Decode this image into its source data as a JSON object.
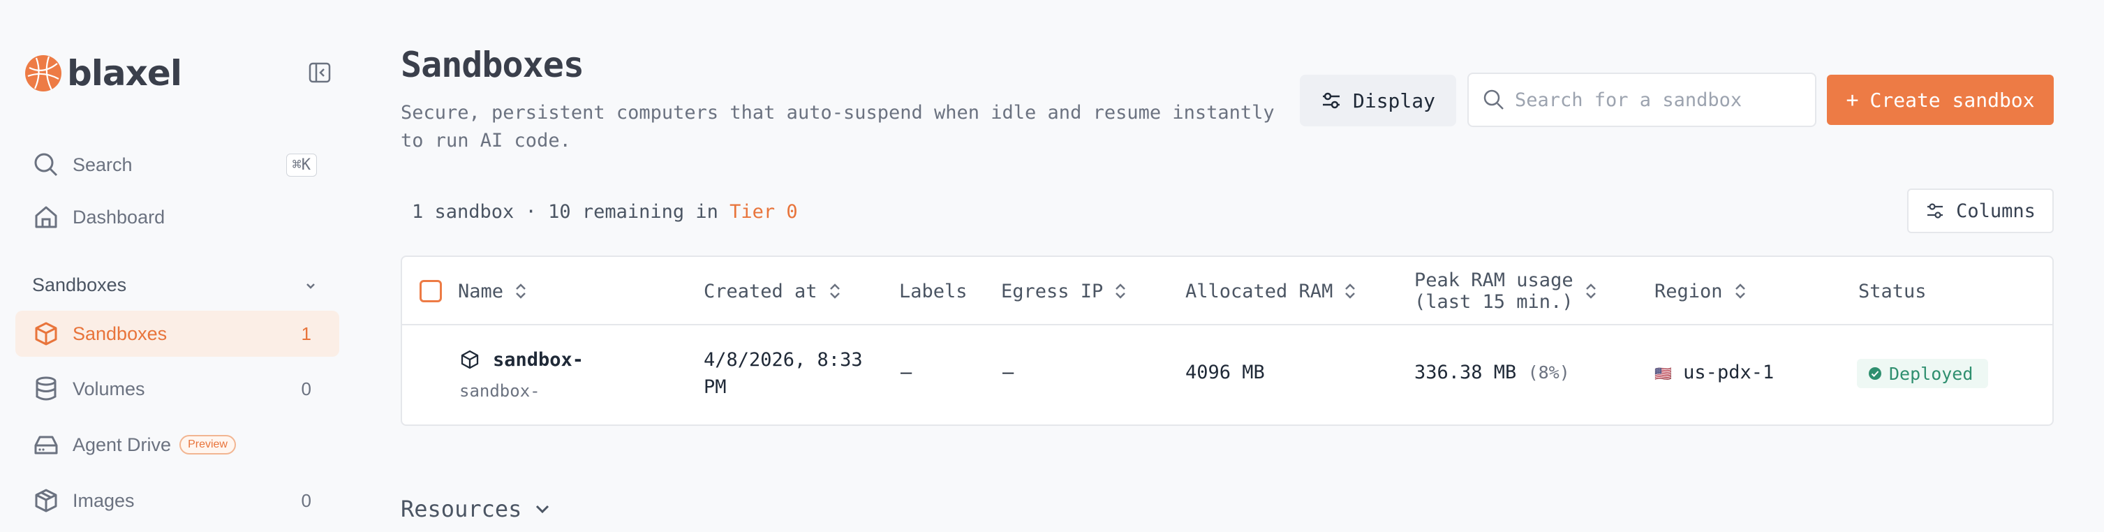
{
  "brand": {
    "name": "blaxel",
    "accent": "#ed7b45"
  },
  "sidebar": {
    "search_label": "Search",
    "search_shortcut": "⌘K",
    "dashboard_label": "Dashboard",
    "section_label": "Sandboxes",
    "items": [
      {
        "label": "Sandboxes",
        "count": "1",
        "icon": "cube-icon"
      },
      {
        "label": "Volumes",
        "count": "0",
        "icon": "database-icon"
      },
      {
        "label": "Agent Drive",
        "badge": "Preview",
        "icon": "drive-icon"
      },
      {
        "label": "Images",
        "count": "0",
        "icon": "package-icon"
      }
    ]
  },
  "header": {
    "title": "Sandboxes",
    "description": "Secure, persistent computers that auto-suspend when idle and resume instantly to run AI code.",
    "display_label": "Display",
    "search_placeholder": "Search for a sandbox",
    "create_label": "Create sandbox",
    "create_plus": "+"
  },
  "summary": {
    "text": "1 sandbox · 10 remaining in ",
    "tier": "Tier 0",
    "columns_label": "Columns"
  },
  "table": {
    "columns": {
      "name": "Name",
      "created": "Created at",
      "labels": "Labels",
      "egress": "Egress IP",
      "allocated": "Allocated RAM",
      "peak_line1": "Peak RAM usage",
      "peak_line2": "(last 15 min.)",
      "region": "Region",
      "status": "Status"
    },
    "rows": [
      {
        "name": "sandbox-",
        "subname": "sandbox-",
        "created_line1": "4/8/2026, 8:33",
        "created_line2": "PM",
        "labels": "–",
        "egress": "–",
        "allocated": "4096 MB",
        "peak": "336.38 MB",
        "peak_pct": "(8%)",
        "region_flag": "🇺🇸",
        "region": "us-pdx-1",
        "status": "Deployed"
      }
    ]
  },
  "footer": {
    "resources_label": "Resources"
  }
}
